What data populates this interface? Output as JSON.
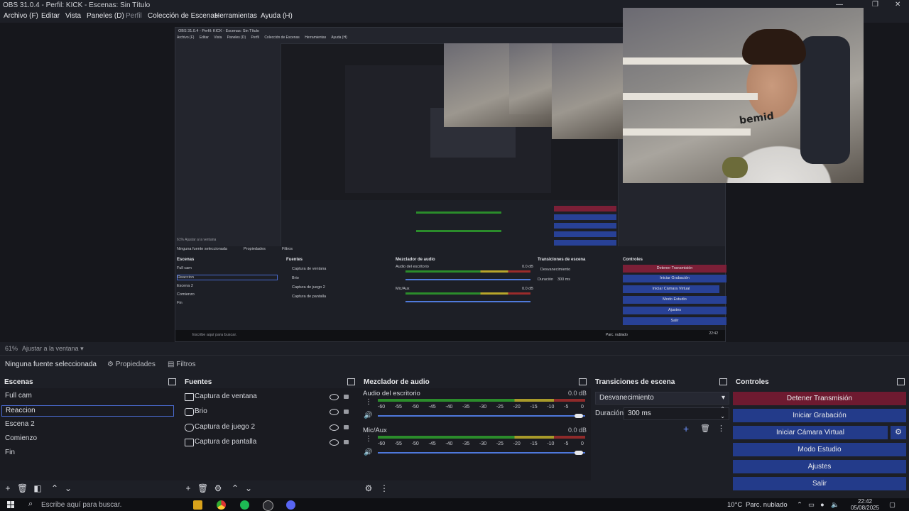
{
  "window": {
    "title": "OBS 31.0.4 - Perfil: KICK - Escenas: Sin Título",
    "controls": [
      "—",
      "❐",
      "✕"
    ]
  },
  "menu": [
    {
      "label": "Archivo (F)"
    },
    {
      "label": "Editar"
    },
    {
      "label": "Vista"
    },
    {
      "label": "Paneles (D)"
    },
    {
      "label": "Perfil"
    },
    {
      "label": "Colección de Escenas"
    },
    {
      "label": "Herramientas"
    },
    {
      "label": "Ayuda (H)"
    }
  ],
  "preview": {
    "zoom": "61%",
    "fit": "Ajustar a la ventana"
  },
  "context": {
    "no_source": "Ninguna fuente seleccionada",
    "properties": "Propiedades",
    "filters": "Filtros"
  },
  "scenes": {
    "title": "Escenas",
    "items": [
      "Full cam",
      "Reaccion",
      "Escena 2",
      "Comienzo",
      "Fin"
    ],
    "selected": "Reaccion"
  },
  "sources": {
    "title": "Fuentes",
    "items": [
      "Captura de ventana",
      "Brio",
      "Captura de juego 2",
      "Captura de pantalla"
    ]
  },
  "mixer": {
    "title": "Mezclador de audio",
    "tracks": [
      {
        "name": "Audio del escritorio",
        "db": "0.0 dB",
        "volume_fraction": 0.97
      },
      {
        "name": "Mic/Aux",
        "db": "0.0 dB",
        "volume_fraction": 0.97
      }
    ],
    "ticks": [
      "-60",
      "-55",
      "-50",
      "-45",
      "-40",
      "-35",
      "-30",
      "-25",
      "-20",
      "-15",
      "-10",
      "-5",
      "0"
    ]
  },
  "transitions": {
    "title": "Transiciones de escena",
    "selected": "Desvanecimiento",
    "duration_label": "Duración",
    "duration_value": "300 ms"
  },
  "controls": {
    "title": "Controles",
    "stop_stream": "Detener Transmisión",
    "start_recording": "Iniciar Grabación",
    "virtual_cam": "Iniciar Cámara Virtual",
    "studio_mode": "Modo Estudio",
    "settings": "Ajustes",
    "exit": "Salir"
  },
  "webcam": {
    "shirt_text": "bemid"
  },
  "taskbar": {
    "search": "Escribe aquí para buscar.",
    "weather": "10°C",
    "weather_desc": "Parc. nublado",
    "time": "22:42",
    "date": "05/08/2025"
  },
  "nested": {
    "title": "OBS 31.0.4 - Perfil: KICK - Escenas: Sin Título",
    "zoom": "61%   Ajustar a la ventana",
    "no_source": "Ninguna fuente seleccionada",
    "properties": "Propiedades",
    "filters": "Filtros",
    "time": "22:42"
  },
  "colors": {
    "accent_blue": "#233b8a",
    "stop_red": "#6e1a30",
    "background": "#1d1f26"
  }
}
